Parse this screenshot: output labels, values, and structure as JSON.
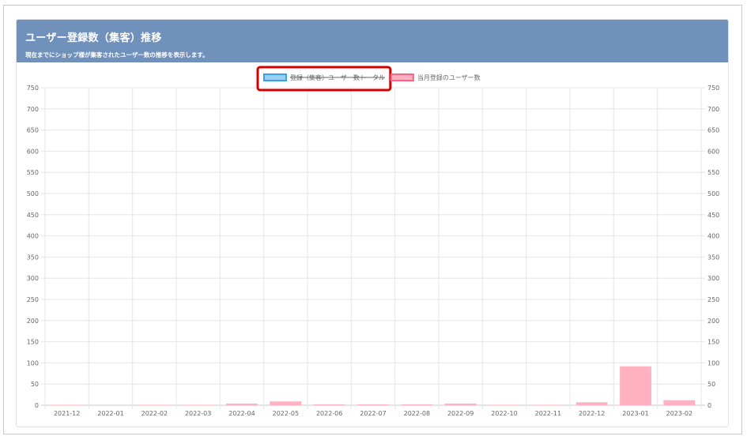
{
  "header": {
    "title": "ユーザー登録数（集客）推移",
    "subtitle": "現在までにショップ様が集客されたユーザー数の推移を表示します。"
  },
  "chart_data": {
    "type": "bar",
    "categories": [
      "2021-12",
      "2022-01",
      "2022-02",
      "2022-03",
      "2022-04",
      "2022-05",
      "2022-06",
      "2022-07",
      "2022-08",
      "2022-09",
      "2022-10",
      "2022-11",
      "2022-12",
      "2023-01",
      "2023-02"
    ],
    "series": [
      {
        "name": "登録（集客）ユーザー数トータル",
        "hidden": true,
        "color": "#9ad0f5",
        "border_color": "#36a2eb",
        "values": []
      },
      {
        "name": "当月登録のユーザー数",
        "hidden": false,
        "color": "#ffb1c1",
        "border_color": "#ff6384",
        "values": [
          1,
          0,
          1,
          1,
          4,
          9,
          2,
          2,
          2,
          4,
          1,
          1,
          7,
          92,
          12
        ]
      }
    ],
    "ylim": [
      0,
      750
    ],
    "yticks": [
      0,
      50,
      100,
      150,
      200,
      250,
      300,
      350,
      400,
      450,
      500,
      550,
      600,
      650,
      700,
      750
    ],
    "grid": true,
    "legend_position": "top",
    "highlight_color": "#d40000"
  }
}
